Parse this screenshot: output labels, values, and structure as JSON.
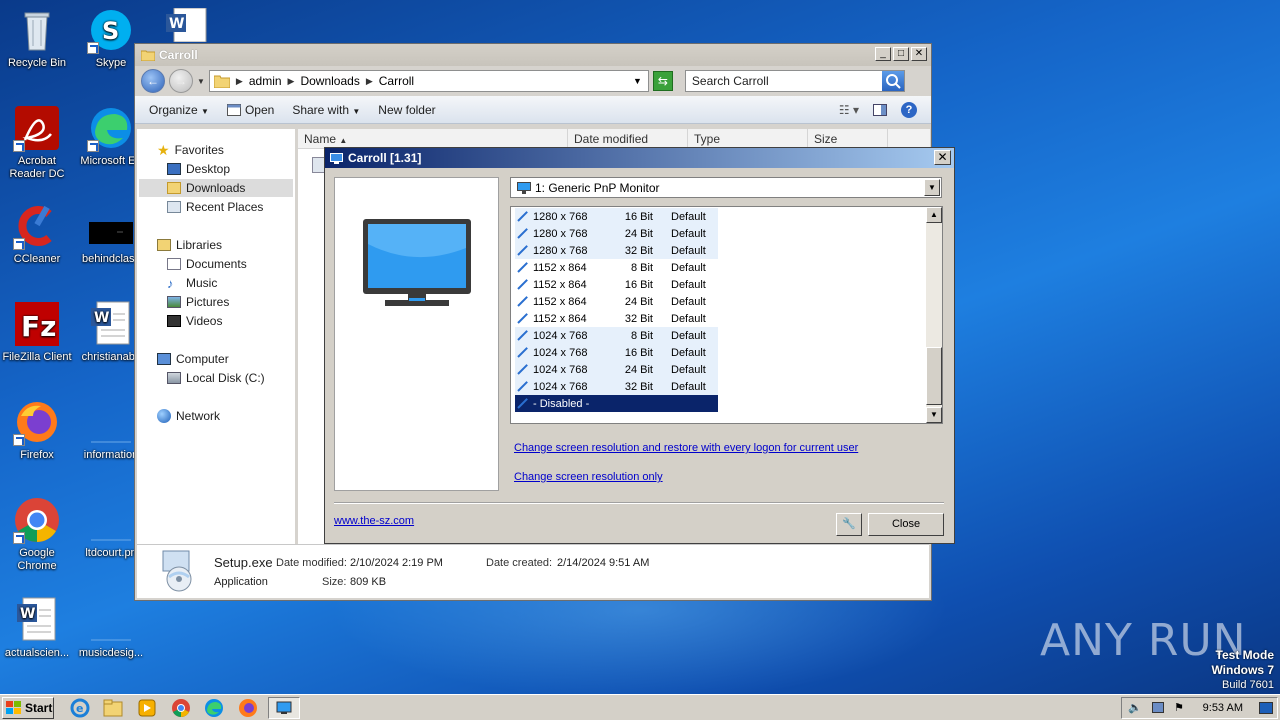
{
  "desktop": {
    "icons": [
      {
        "label": "Recycle Bin"
      },
      {
        "label": "Skype"
      },
      {
        "label": "Acrobat Reader DC"
      },
      {
        "label": "Microsoft Ed"
      },
      {
        "label": "CCleaner"
      },
      {
        "label": "behindclass"
      },
      {
        "label": "FileZilla Client"
      },
      {
        "label": "christianabs"
      },
      {
        "label": "Firefox"
      },
      {
        "label": "information"
      },
      {
        "label": "Google Chrome"
      },
      {
        "label": "ltdcourt.pn"
      },
      {
        "label": "actualscien..."
      },
      {
        "label": "musicdesig..."
      }
    ]
  },
  "explorer": {
    "title": "Carroll",
    "breadcrumb": [
      "admin",
      "Downloads",
      "Carroll"
    ],
    "search_placeholder": "Search Carroll",
    "toolbar": {
      "organize": "Organize",
      "open": "Open",
      "share_with": "Share with",
      "new_folder": "New folder"
    },
    "nav": {
      "favorites": "Favorites",
      "desktop": "Desktop",
      "downloads": "Downloads",
      "recent": "Recent Places",
      "libraries": "Libraries",
      "documents": "Documents",
      "music": "Music",
      "pictures": "Pictures",
      "videos": "Videos",
      "computer": "Computer",
      "local_disk": "Local Disk (C:)",
      "network": "Network"
    },
    "columns": {
      "name": "Name",
      "date": "Date modified",
      "type": "Type",
      "size": "Size"
    },
    "details": {
      "filename": "Setup.exe",
      "kind": "Application",
      "date_modified_label": "Date modified:",
      "date_modified": "2/10/2024 2:19 PM",
      "date_created_label": "Date created:",
      "date_created": "2/14/2024 9:51 AM",
      "size_label": "Size:",
      "size": "809 KB"
    }
  },
  "dialog": {
    "title": "Carroll [1.31]",
    "monitor": "1: Generic PnP Monitor",
    "modes": [
      {
        "res": "1280 x 768",
        "bits": "16 Bit",
        "label": "Default"
      },
      {
        "res": "1280 x 768",
        "bits": "24 Bit",
        "label": "Default"
      },
      {
        "res": "1280 x 768",
        "bits": "32 Bit",
        "label": "Default"
      },
      {
        "res": "1152 x 864",
        "bits": "8 Bit",
        "label": "Default"
      },
      {
        "res": "1152 x 864",
        "bits": "16 Bit",
        "label": "Default"
      },
      {
        "res": "1152 x 864",
        "bits": "24 Bit",
        "label": "Default"
      },
      {
        "res": "1152 x 864",
        "bits": "32 Bit",
        "label": "Default"
      },
      {
        "res": "1024 x 768",
        "bits": "8 Bit",
        "label": "Default"
      },
      {
        "res": "1024 x 768",
        "bits": "16 Bit",
        "label": "Default"
      },
      {
        "res": "1024 x 768",
        "bits": "24 Bit",
        "label": "Default"
      },
      {
        "res": "1024 x 768",
        "bits": "32 Bit",
        "label": "Default"
      }
    ],
    "disabled_item": "- Disabled -",
    "link_restore": "Change screen resolution and restore with every logon for current user",
    "link_only": "Change screen resolution only",
    "website": "www.the-sz.com",
    "close": "Close"
  },
  "taskbar": {
    "start": "Start",
    "clock": "9:53 AM"
  },
  "watermark": {
    "line1": "Test Mode",
    "line2": "Windows 7",
    "line3": "Build 7601",
    "brand": "ANY RUN"
  }
}
